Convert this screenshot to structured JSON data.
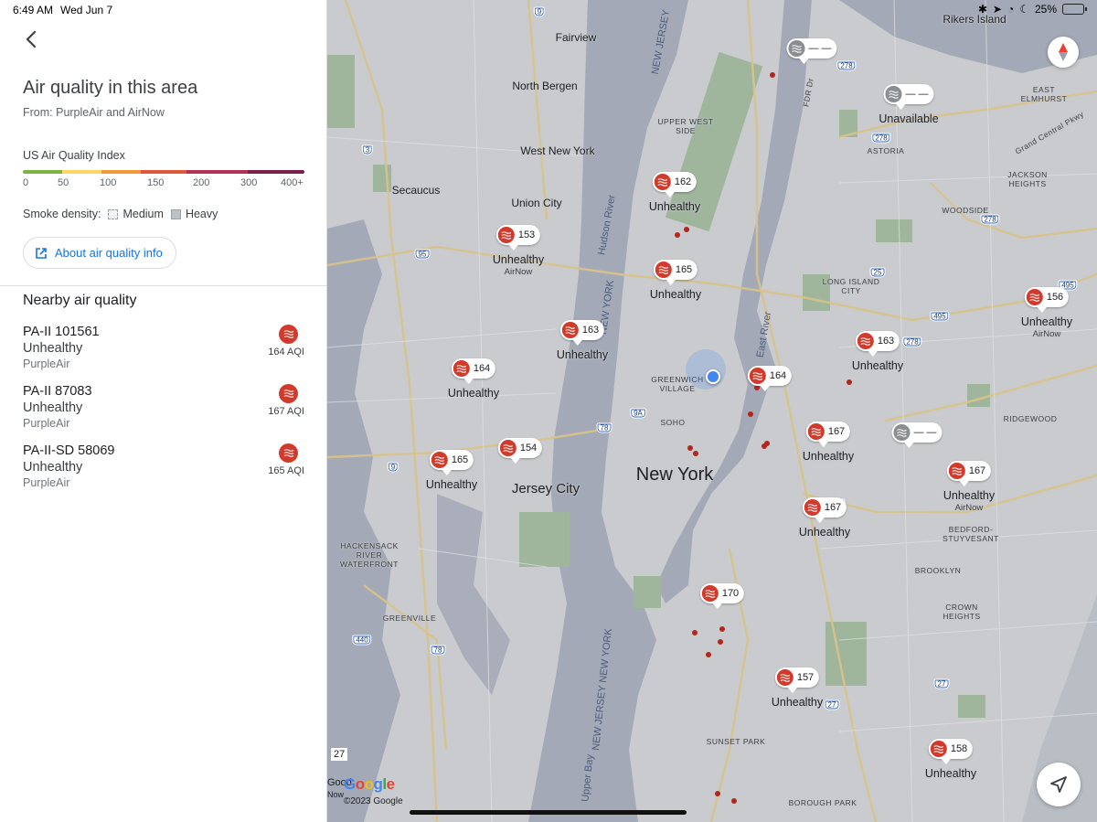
{
  "status_bar": {
    "time": "6:49 AM",
    "date": "Wed Jun 7",
    "battery": "25%"
  },
  "panel": {
    "title": "Air quality in this area",
    "source": "From: PurpleAir and AirNow",
    "index_label": "US Air Quality Index",
    "scale_ticks": [
      "0",
      "50",
      "100",
      "150",
      "200",
      "300",
      "400+"
    ],
    "scale_colors": [
      "#7cb342",
      "#fdd663",
      "#f29a38",
      "#e0573a",
      "#b03356",
      "#7b1e4a"
    ],
    "smoke_label": "Smoke density:",
    "smoke_medium": "Medium",
    "smoke_heavy": "Heavy",
    "about_button": "About air quality info",
    "nearby_title": "Nearby air quality",
    "stations": [
      {
        "name": "PA-II 101561",
        "status": "Unhealthy",
        "source": "PurpleAir",
        "aqi": "164 AQI"
      },
      {
        "name": "PA-II 87083",
        "status": "Unhealthy",
        "source": "PurpleAir",
        "aqi": "167 AQI"
      },
      {
        "name": "PA-II-SD 58069",
        "status": "Unhealthy",
        "source": "PurpleAir",
        "aqi": "165 AQI"
      }
    ]
  },
  "map": {
    "place_labels": [
      {
        "text": "Rikers Island",
        "cls": ""
      },
      {
        "text": "Fairview",
        "cls": ""
      },
      {
        "text": "North Bergen",
        "cls": ""
      },
      {
        "text": "West New York",
        "cls": ""
      },
      {
        "text": "Secaucus",
        "cls": ""
      },
      {
        "text": "Union City",
        "cls": ""
      },
      {
        "text": "UPPER WEST SIDE",
        "cls": "small"
      },
      {
        "text": "EAST ELMHURST",
        "cls": "small"
      },
      {
        "text": "ASTORIA",
        "cls": "small"
      },
      {
        "text": "JACKSON HEIGHTS",
        "cls": "small"
      },
      {
        "text": "WOODSIDE",
        "cls": "small"
      },
      {
        "text": "LONG ISLAND CITY",
        "cls": "small"
      },
      {
        "text": "GREENWICH VILLAGE",
        "cls": "small"
      },
      {
        "text": "SOHO",
        "cls": "small"
      },
      {
        "text": "RIDGEWOOD",
        "cls": "small"
      },
      {
        "text": "New York",
        "cls": "big"
      },
      {
        "text": "Jersey City",
        "cls": "mid"
      },
      {
        "text": "BEDFORD-STUYVESANT",
        "cls": "small"
      },
      {
        "text": "BROOKLYN",
        "cls": "small"
      },
      {
        "text": "CROWN HEIGHTS",
        "cls": "small"
      },
      {
        "text": "HACKENSACK RIVER WATERFRONT",
        "cls": "small"
      },
      {
        "text": "GREENVILLE",
        "cls": "small"
      },
      {
        "text": "SUNSET PARK",
        "cls": "small"
      },
      {
        "text": "BOROUGH PARK",
        "cls": "small"
      },
      {
        "text": "Hudson River",
        "cls": "water"
      },
      {
        "text": "NEW YORK",
        "cls": "water"
      },
      {
        "text": "East River",
        "cls": "water"
      },
      {
        "text": "NEW JERSEY",
        "cls": "water"
      },
      {
        "text": "NEW JERSEY NEW YORK",
        "cls": "water"
      },
      {
        "text": "Upper Bay",
        "cls": "water"
      },
      {
        "text": "Grand Central Pkwy",
        "cls": "small"
      },
      {
        "text": "FDR Dr",
        "cls": "small"
      }
    ],
    "route_shields": [
      "9",
      "278",
      "3",
      "95",
      "278",
      "278",
      "25",
      "495",
      "495",
      "278",
      "78",
      "9A",
      "9",
      "9",
      "278",
      "440",
      "78",
      "27",
      "27"
    ],
    "markers": [
      {
        "value": "— —",
        "status": "",
        "source": "",
        "gray": true
      },
      {
        "value": "— —",
        "status": "Unavailable",
        "source": "",
        "gray": true
      },
      {
        "value": "162",
        "status": "Unhealthy",
        "source": "",
        "gray": false
      },
      {
        "value": "153",
        "status": "Unhealthy",
        "source": "AirNow",
        "gray": false
      },
      {
        "value": "165",
        "status": "Unhealthy",
        "source": "",
        "gray": false
      },
      {
        "value": "163",
        "status": "Unhealthy",
        "source": "",
        "gray": false
      },
      {
        "value": "164",
        "status": "Unhealthy",
        "source": "",
        "gray": false
      },
      {
        "value": "164",
        "status": "",
        "source": "",
        "gray": false
      },
      {
        "value": "163",
        "status": "Unhealthy",
        "source": "",
        "gray": false
      },
      {
        "value": "156",
        "status": "Unhealthy",
        "source": "AirNow",
        "gray": false
      },
      {
        "value": "167",
        "status": "Unhealthy",
        "source": "",
        "gray": false
      },
      {
        "value": "— —",
        "status": "",
        "source": "",
        "gray": true
      },
      {
        "value": "167",
        "status": "Unhealthy",
        "source": "AirNow",
        "gray": false
      },
      {
        "value": "165",
        "status": "Unhealthy",
        "source": "",
        "gray": false
      },
      {
        "value": "154",
        "status": "",
        "source": "",
        "gray": false
      },
      {
        "value": "167",
        "status": "Unhealthy",
        "source": "",
        "gray": false
      },
      {
        "value": "170",
        "status": "",
        "source": "",
        "gray": false
      },
      {
        "value": "157",
        "status": "Unhealthy",
        "source": "",
        "gray": false
      },
      {
        "value": "158",
        "status": "Unhealthy",
        "source": "",
        "gray": false
      }
    ],
    "edge_labels": {
      "left_27": "27",
      "left_good": "Good",
      "left_now": "Now"
    },
    "logo": "Google",
    "copyright": "©2023 Google"
  }
}
